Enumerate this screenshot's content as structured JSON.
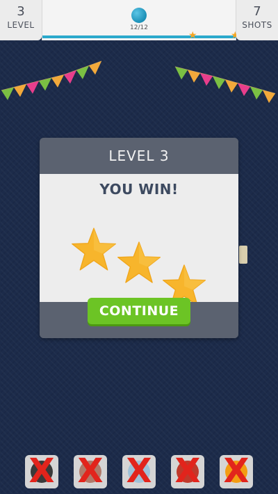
{
  "hud": {
    "level_number": "3",
    "level_label": "LEVEL",
    "shots_number": "7",
    "shots_label": "SHOTS",
    "progress_text": "12/12",
    "progress_fraction": 1.0
  },
  "modal": {
    "title": "LEVEL 3",
    "result": "YOU WIN!",
    "stars_earned": 3,
    "continue_label": "CONTINUE"
  },
  "bottom": {
    "slots": [
      {
        "icon": "blocked-item-icon",
        "color": "#3a3a3a",
        "mark": "X"
      },
      {
        "icon": "blocked-item-icon",
        "color": "#b07a6a",
        "mark": "X"
      },
      {
        "icon": "blocked-item-icon",
        "color": "#9fc2d8",
        "mark": "X"
      },
      {
        "icon": "blocked-item-icon",
        "color": "#c0392b",
        "mark": "X"
      },
      {
        "icon": "blocked-item-icon",
        "color": "#f39c12",
        "mark": "X"
      }
    ]
  },
  "colors": {
    "background": "#1c2b4a",
    "accent_green": "#6cc425",
    "star_gold": "#f5a623",
    "cross_red": "#e2241c"
  }
}
